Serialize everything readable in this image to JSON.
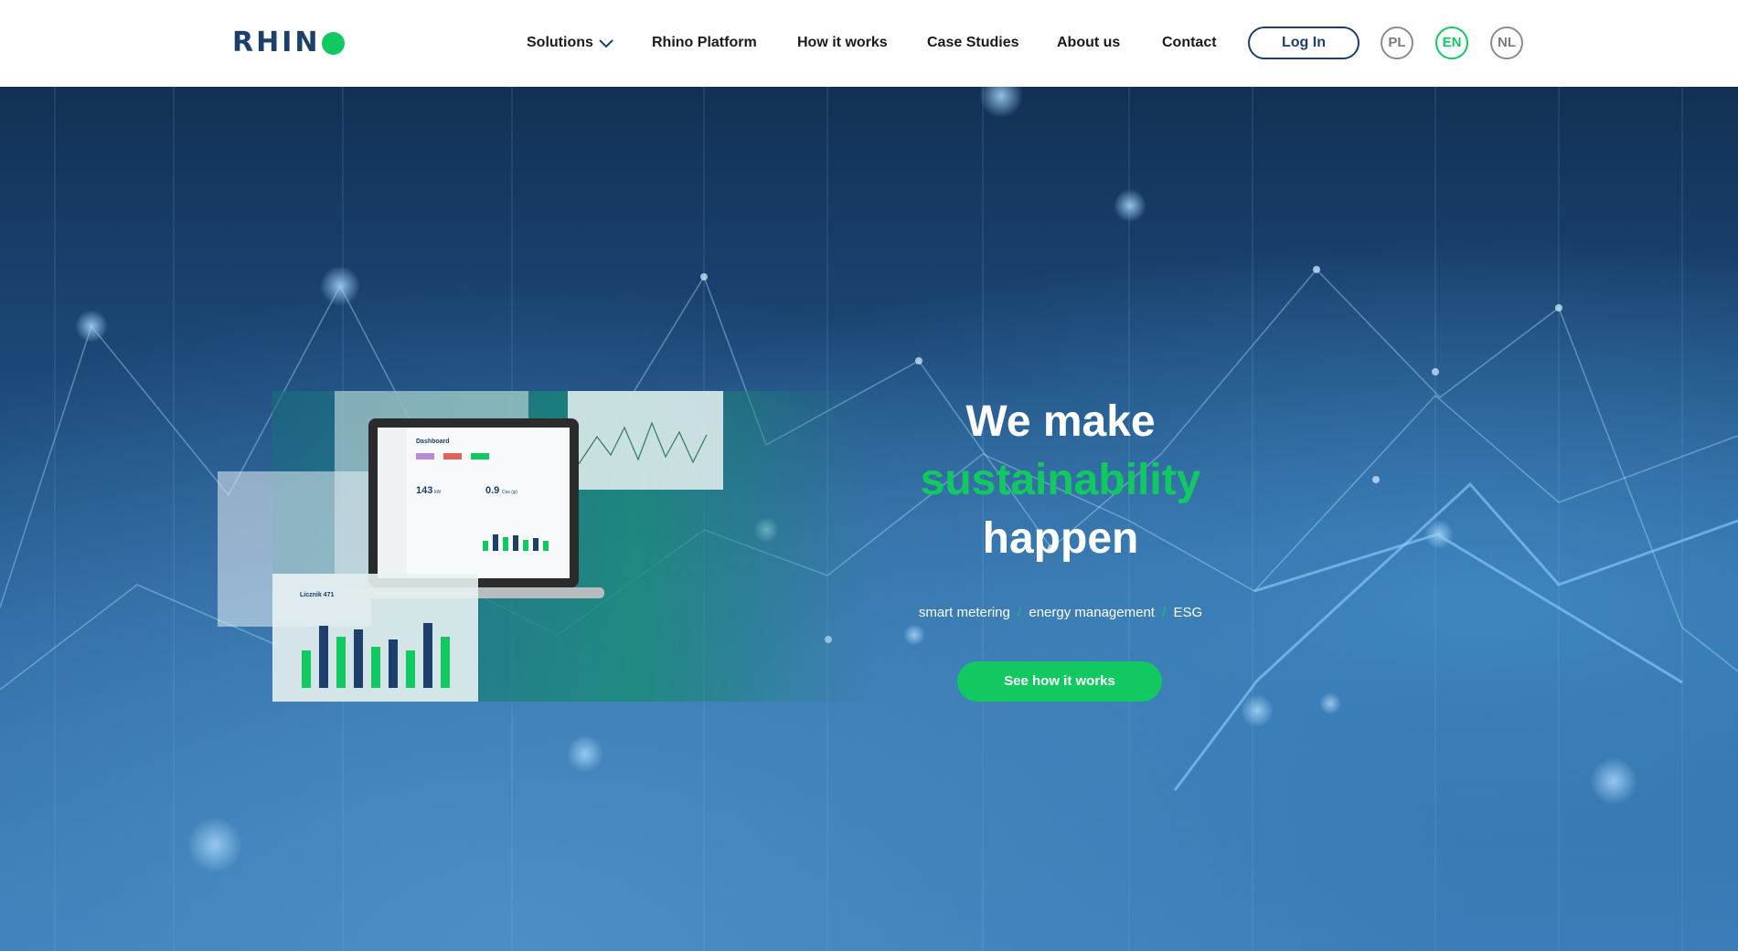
{
  "logo": {
    "text": "RHIN",
    "dot_color": "#12c961",
    "text_color": "#1c3f6b"
  },
  "nav": {
    "items": [
      {
        "label": "Solutions",
        "has_dropdown": true
      },
      {
        "label": "Rhino Platform"
      },
      {
        "label": "How it works"
      },
      {
        "label": "Case Studies"
      },
      {
        "label": "About us"
      },
      {
        "label": "Contact"
      }
    ],
    "login_label": "Log In",
    "languages": [
      {
        "code": "PL",
        "active": false
      },
      {
        "code": "EN",
        "active": true
      },
      {
        "code": "NL",
        "active": false
      }
    ]
  },
  "hero": {
    "headline_line1": "We make",
    "headline_line2": "sustainability",
    "headline_line3": "happen",
    "tags": [
      "smart metering",
      "energy management",
      "ESG"
    ],
    "separator": "/",
    "cta_label": "See how it works"
  },
  "showcase": {
    "dashboard_title": "Dashboard",
    "metric_1": "143",
    "metric_1_unit": "kW",
    "metric_2": "0.9",
    "metric_2_unit": "Cos (φ)",
    "panel_title": "Licznik 471",
    "bar_values": [
      0.55,
      0.9,
      0.75,
      0.85,
      0.6,
      0.7,
      0.55,
      0.95,
      0.75
    ]
  },
  "colors": {
    "accent": "#12c961",
    "brand_navy": "#1c3f6b"
  }
}
